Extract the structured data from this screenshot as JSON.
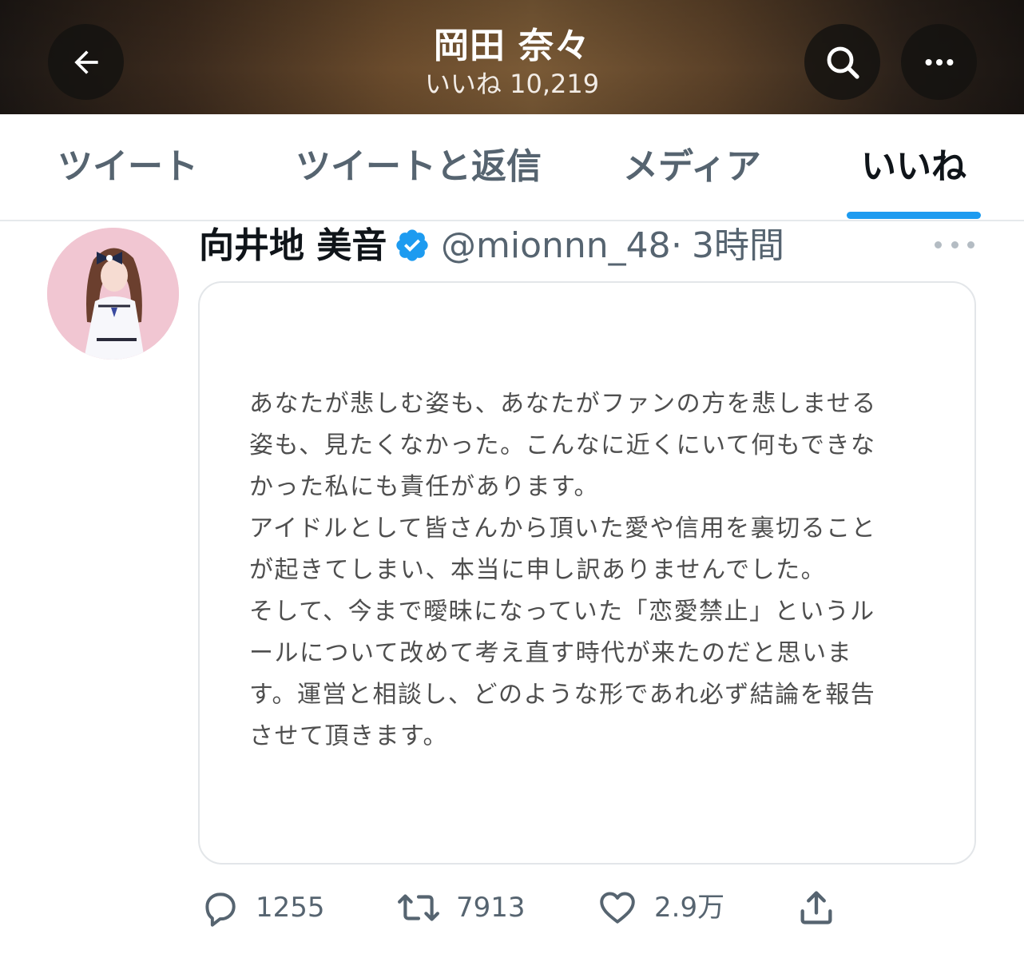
{
  "header": {
    "title": "岡田 奈々",
    "subtitle": "いいね 10,219",
    "icons": {
      "back": "arrow-left-icon",
      "search": "search-icon",
      "more": "more-horizontal-icon"
    }
  },
  "tabs": [
    {
      "label": "ツイート",
      "active": false
    },
    {
      "label": "ツイートと返信",
      "active": false
    },
    {
      "label": "メディア",
      "active": false
    },
    {
      "label": "いいね",
      "active": true
    }
  ],
  "tweet": {
    "author_name": "向井地 美音",
    "handle": "@mionnn_48",
    "separator": "·",
    "time": "3時間",
    "verified": true,
    "image_text_lines": [
      "あなたが悲しむ姿も、あなたがファンの方を悲しませる",
      "姿も、見たくなかった。こんなに近くにいて何もできな",
      "かった私にも責任があります。",
      "アイドルとして皆さんから頂いた愛や信用を裏切ること",
      "が起きてしまい、本当に申し訳ありませんでした。",
      "そして、今まで曖昧になっていた「恋愛禁止」というル",
      "ールについて改めて考え直す時代が来たのだと思いま",
      "す。運営と相談し、どのような形であれ必ず結論を報告",
      "させて頂きます。"
    ],
    "actions": {
      "reply_count": "1255",
      "retweet_count": "7913",
      "like_count": "2.9万"
    }
  },
  "colors": {
    "accent": "#1d9bf0",
    "text_primary": "#0f1419",
    "text_secondary": "#566470",
    "border": "#e3e6e9"
  }
}
